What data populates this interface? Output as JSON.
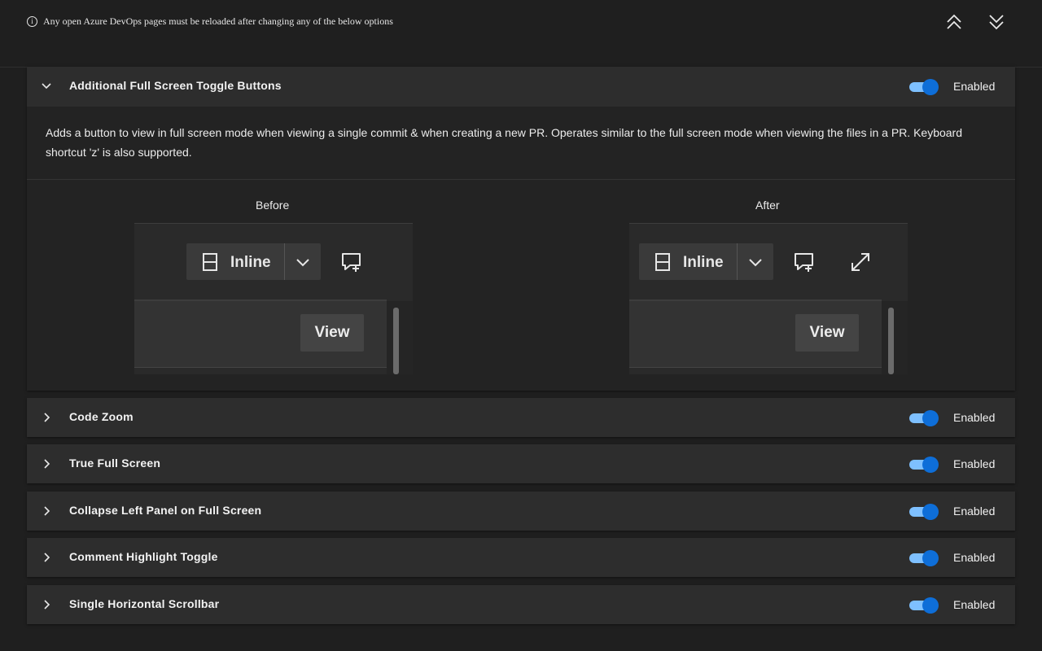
{
  "top_bar": {
    "info_icon": "info-icon",
    "notice": "Any open Azure DevOps pages must be reloaded after changing any of the below options",
    "collapse_all_icon": "double-chevron-up-icon",
    "expand_all_icon": "double-chevron-down-icon"
  },
  "expanded_feature": {
    "title": "Additional Full Screen Toggle Buttons",
    "status": "Enabled",
    "enabled": true,
    "description": "Adds a button to view in full screen mode when viewing a single commit & when creating a new PR. Operates similar to the full screen mode when viewing the files in a PR. Keyboard shortcut 'z' is also supported.",
    "before": {
      "caption": "Before",
      "mode_label": "Inline",
      "view_label": "View"
    },
    "after": {
      "caption": "After",
      "mode_label": "Inline",
      "view_label": "View"
    }
  },
  "features": [
    {
      "title": "Code Zoom",
      "status": "Enabled",
      "enabled": true
    },
    {
      "title": "True Full Screen",
      "status": "Enabled",
      "enabled": true
    },
    {
      "title": "Collapse Left Panel on Full Screen",
      "status": "Enabled",
      "enabled": true
    },
    {
      "title": "Comment Highlight Toggle",
      "status": "Enabled",
      "enabled": true
    },
    {
      "title": "Single Horizontal Scrollbar",
      "status": "Enabled",
      "enabled": true
    }
  ],
  "colors": {
    "background": "#1f1f1f",
    "panel": "#2d2d2d",
    "toggle_track": "#7ec0ff",
    "toggle_knob": "#0e6ed8"
  }
}
